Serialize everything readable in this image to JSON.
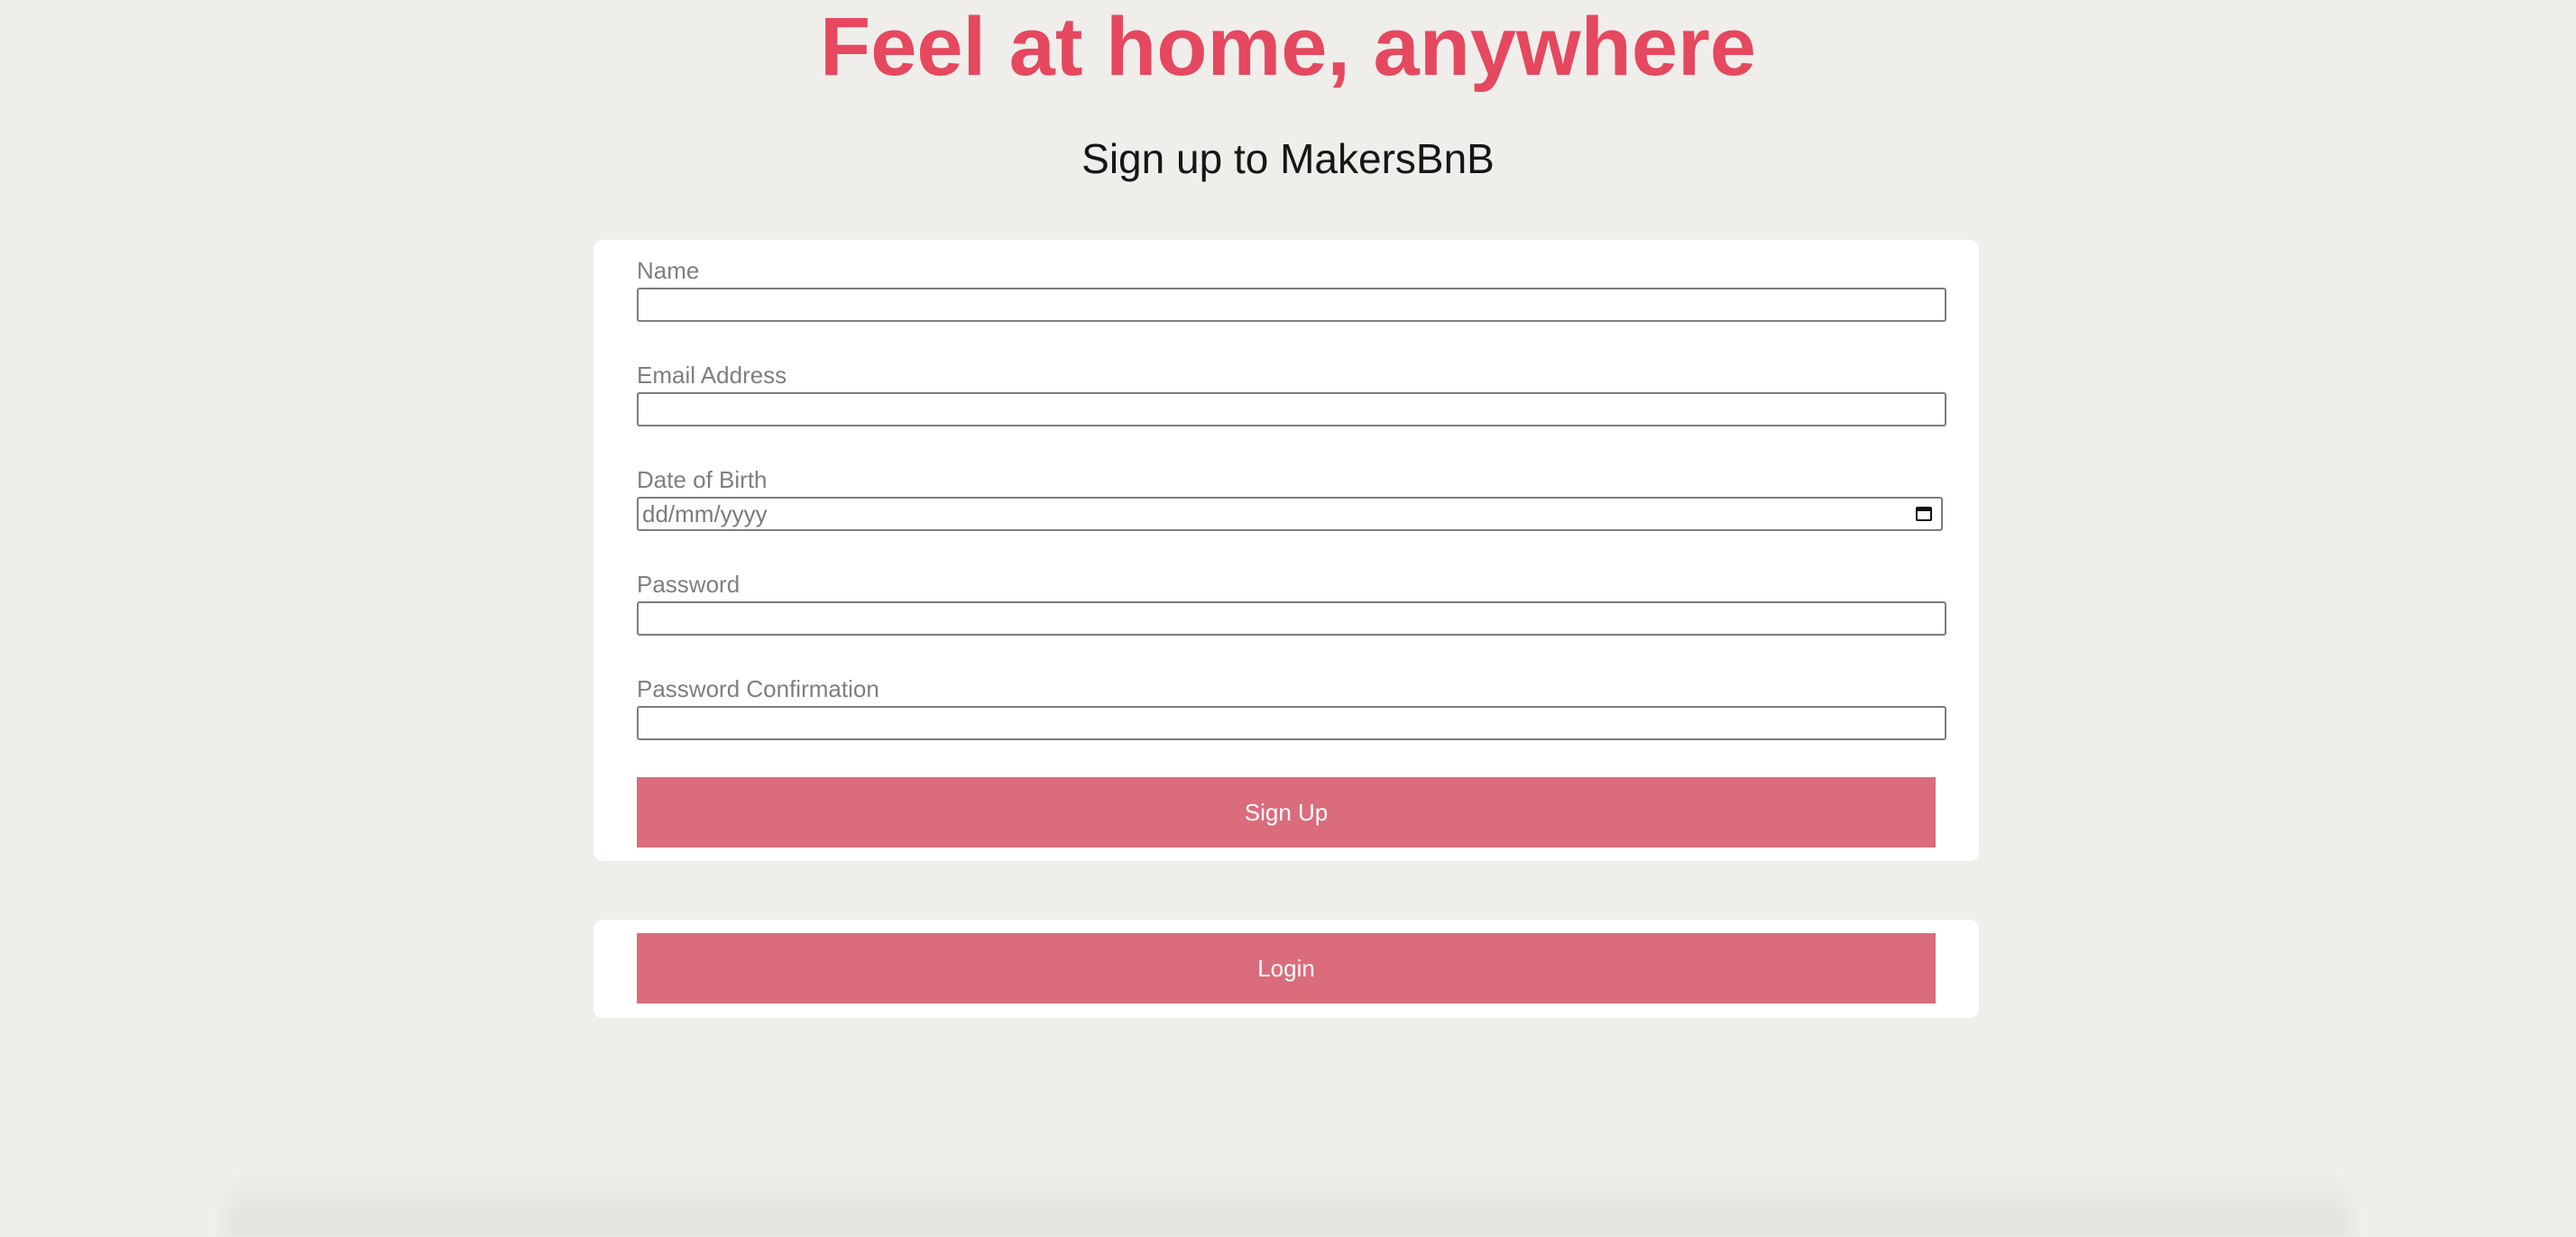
{
  "header": {
    "title": "Feel at home, anywhere",
    "subtitle": "Sign up to MakersBnB"
  },
  "signup_form": {
    "fields": [
      {
        "label": "Name",
        "value": ""
      },
      {
        "label": "Email Address",
        "value": ""
      },
      {
        "label": "Date of Birth",
        "placeholder": "dd/mm/yyyy",
        "icon": "calendar-icon"
      },
      {
        "label": "Password",
        "value": ""
      },
      {
        "label": "Password Confirmation",
        "value": ""
      }
    ],
    "submit_label": "Sign Up"
  },
  "login": {
    "button_label": "Login"
  },
  "colors": {
    "title": "#e5485f",
    "button": "#da6c7c",
    "background": "#efeeea",
    "card": "#ffffff"
  }
}
